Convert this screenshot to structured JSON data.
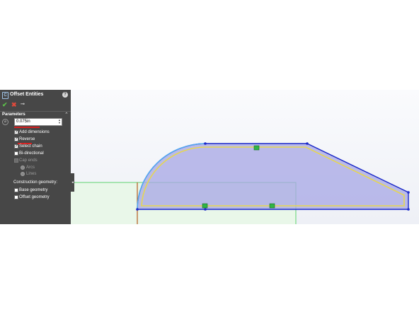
{
  "property_manager": {
    "title": "Offset Entities",
    "help_icon": "question-icon",
    "actions": {
      "ok_icon": "checkmark-icon",
      "cancel_icon": "x-icon",
      "pin_icon": "pushpin-icon"
    },
    "parameters": {
      "title": "Parameters",
      "offset_distance": "0.075in",
      "options": [
        {
          "label": "Add dimensions",
          "checked": true,
          "enabled": true
        },
        {
          "label": "Reverse",
          "checked": true,
          "enabled": true
        },
        {
          "label": "Select chain",
          "checked": true,
          "enabled": true
        },
        {
          "label": "Bi-directional",
          "checked": false,
          "enabled": true
        },
        {
          "label": "Cap ends",
          "checked": false,
          "enabled": false
        }
      ],
      "cap_end_types": [
        "Arcs",
        "Lines"
      ],
      "construction_geometry_label": "Construction geometry:",
      "construction_options": [
        {
          "label": "Base geometry",
          "checked": false
        },
        {
          "label": "Offset geometry",
          "checked": false
        }
      ]
    }
  },
  "colors": {
    "panel_bg": "#474747",
    "selected_profile": "#1a28c8",
    "offset_preview": "#e6d650",
    "region_fill": "#a9a9e6",
    "green_rect": "#5fd36f",
    "vertical_line": "#b45a1e",
    "annotation_red": "#d62020"
  }
}
